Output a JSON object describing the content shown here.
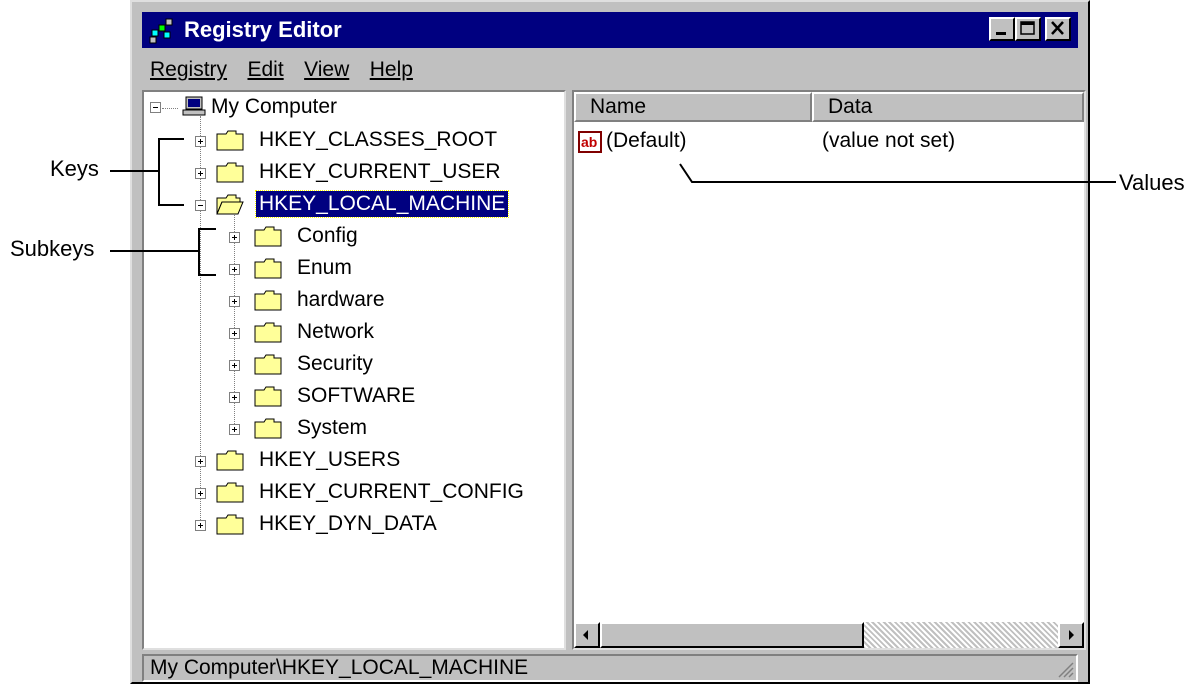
{
  "window": {
    "title": "Registry Editor"
  },
  "menu": [
    "Registry",
    "Edit",
    "View",
    "Help"
  ],
  "tree": {
    "root": "My Computer",
    "keys": [
      "HKEY_CLASSES_ROOT",
      "HKEY_CURRENT_USER",
      "HKEY_LOCAL_MACHINE"
    ],
    "subkeys": [
      "Config",
      "Enum",
      "hardware",
      "Network",
      "Security",
      "SOFTWARE",
      "System"
    ],
    "more_keys": [
      "HKEY_USERS",
      "HKEY_CURRENT_CONFIG",
      "HKEY_DYN_DATA"
    ],
    "selected": "HKEY_LOCAL_MACHINE"
  },
  "list": {
    "columns": [
      "Name",
      "Data"
    ],
    "rows": [
      {
        "name": "(Default)",
        "data": "(value not set)",
        "icon": "string-value-icon"
      }
    ]
  },
  "status": "My Computer\\HKEY_LOCAL_MACHINE",
  "annotations": {
    "keys": "Keys",
    "subkeys": "Subkeys",
    "values": "Values"
  },
  "colors": {
    "titlebar": "#000080",
    "selection": "#000080",
    "face": "#c0c0c0",
    "folder": "#ffff99"
  }
}
